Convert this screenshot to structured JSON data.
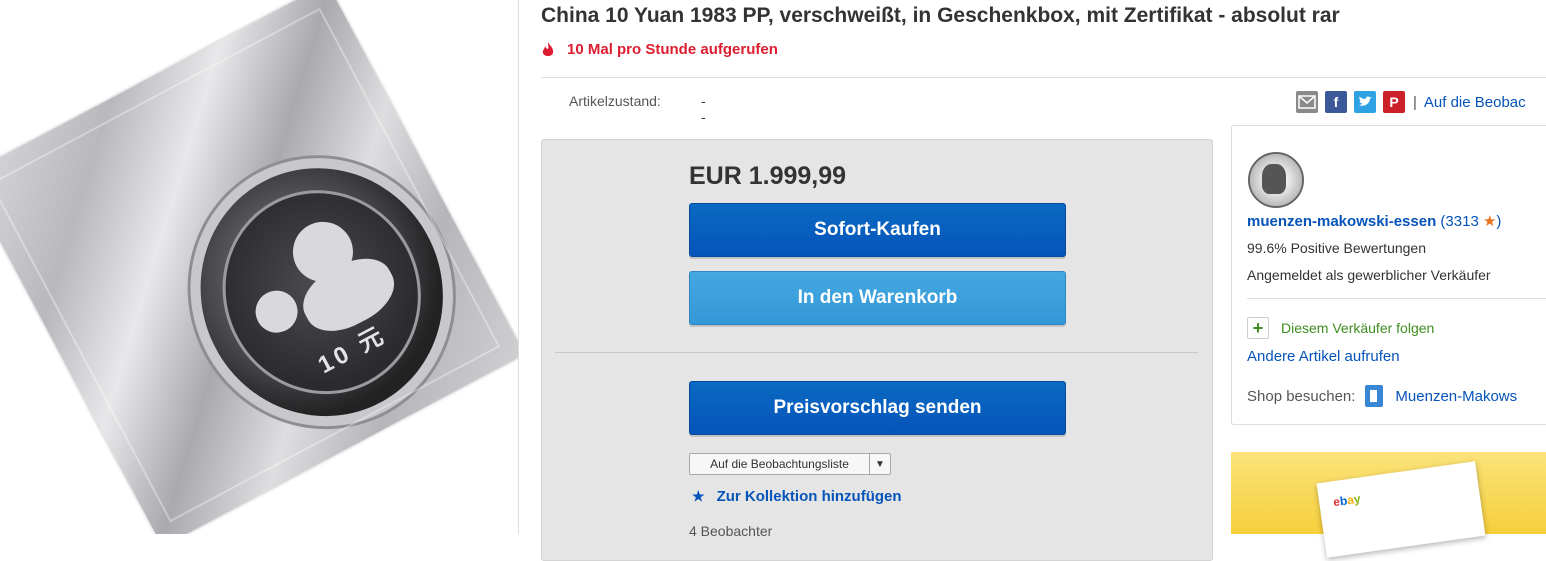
{
  "product_image": {
    "coin_value_text": "10 元"
  },
  "listing": {
    "title": "China 10 Yuan 1983 PP, verschweißt, in Geschenkbox, mit Zertifikat - absolut rar",
    "views_text": "10 Mal pro Stunde aufgerufen",
    "condition_label": "Artikelzustand:",
    "condition_value": "--"
  },
  "share": {
    "icons": [
      "email-icon",
      "facebook-icon",
      "twitter-icon",
      "pinterest-icon"
    ],
    "separator": "|",
    "watch_link": "Auf die Beobac"
  },
  "buybox": {
    "price": "EUR 1.999,99",
    "buy_now_label": "Sofort-Kaufen",
    "add_to_cart_label": "In den Warenkorb",
    "best_offer_label": "Preisvorschlag senden",
    "watchlist_select": "Auf die Beobachtungsliste",
    "collection_label": "Zur Kollektion hinzufügen",
    "watchers_text": "4 Beobachter"
  },
  "seller": {
    "name": "muenzen-makowski-essen",
    "feedback_open": "(3313",
    "feedback_close": ")",
    "positive": "99.6% Positive Bewertungen",
    "registered": "Angemeldet als gewerblicher Verkäufer",
    "follow_label": "Diesem Verkäufer folgen",
    "other_items": "Andere Artikel aufrufen",
    "shop_label": "Shop besuchen:",
    "shop_name": "Muenzen-Makows"
  },
  "ad": {
    "logo_text": "ebay"
  },
  "colors": {
    "link_blue": "#0654ba",
    "alert_red": "#dd1e31",
    "follow_green": "#3d8e1f",
    "button_blue": "#0654ba",
    "button_light_blue": "#3498d8"
  }
}
